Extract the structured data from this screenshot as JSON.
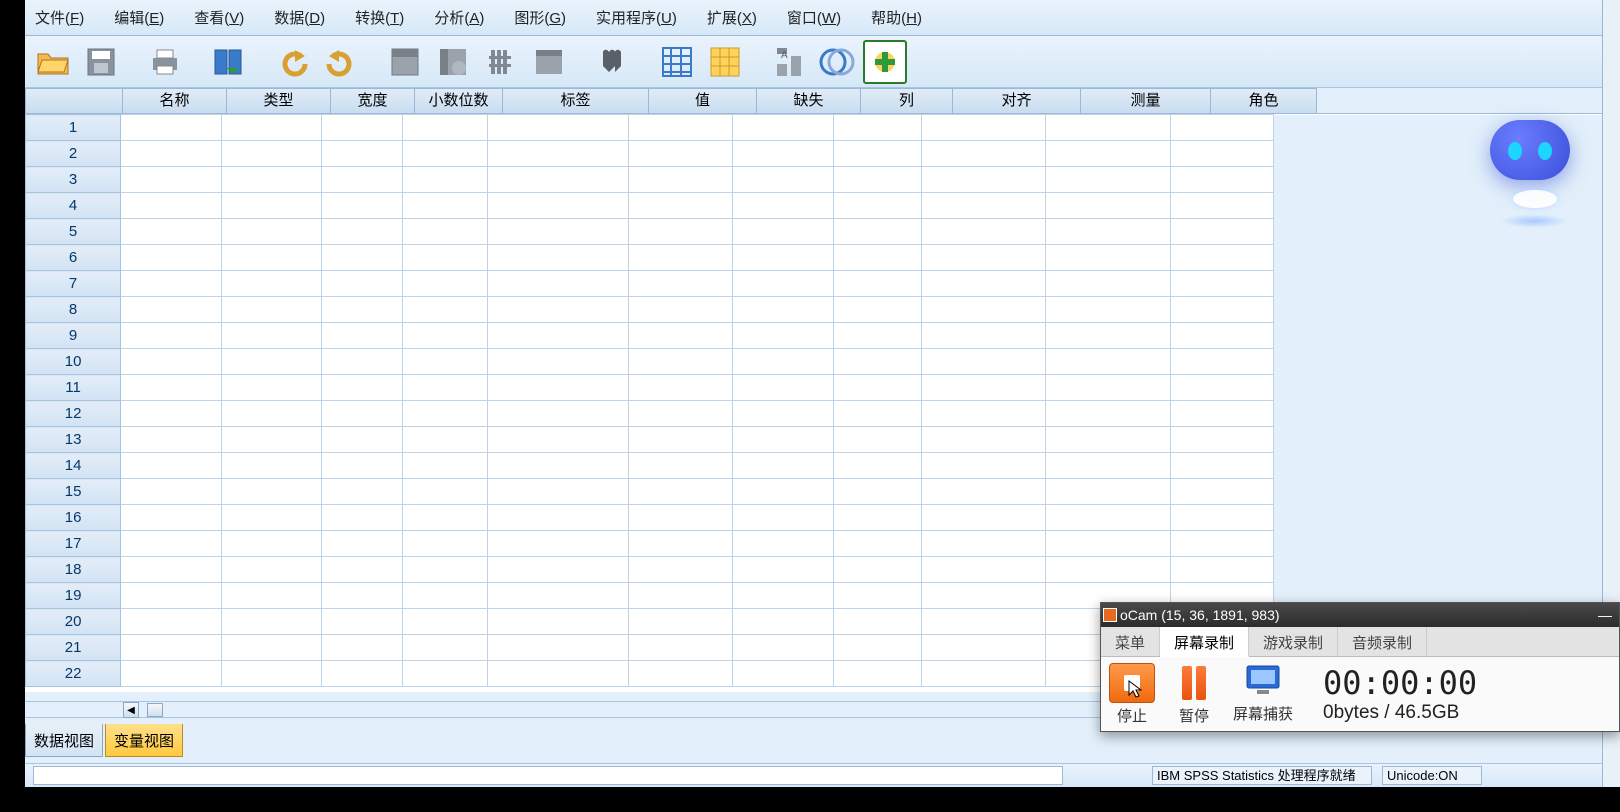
{
  "menu": {
    "file": {
      "label": "文件",
      "key": "F"
    },
    "edit": {
      "label": "编辑",
      "key": "E"
    },
    "view": {
      "label": "查看",
      "key": "V"
    },
    "data": {
      "label": "数据",
      "key": "D"
    },
    "transform": {
      "label": "转换",
      "key": "T"
    },
    "analyze": {
      "label": "分析",
      "key": "A"
    },
    "graphs": {
      "label": "图形",
      "key": "G"
    },
    "utilities": {
      "label": "实用程序",
      "key": "U"
    },
    "extensions": {
      "label": "扩展",
      "key": "X"
    },
    "window": {
      "label": "窗口",
      "key": "W"
    },
    "help": {
      "label": "帮助",
      "key": "H"
    }
  },
  "columns": {
    "name": "名称",
    "type": "类型",
    "width": "宽度",
    "decimals": "小数位数",
    "label": "标签",
    "values": "值",
    "missing": "缺失",
    "columns_col": "列",
    "align": "对齐",
    "measure": "测量",
    "role": "角色"
  },
  "row_count": 22,
  "tabs": {
    "data_view": "数据视图",
    "variable_view": "变量视图"
  },
  "status": {
    "processor": "IBM SPSS Statistics 处理程序就绪",
    "unicode": "Unicode:ON"
  },
  "recorder": {
    "title": "oCam (15, 36, 1891, 983)",
    "tabs": {
      "menu": "菜单",
      "screen": "屏幕录制",
      "game": "游戏录制",
      "audio": "音频录制"
    },
    "buttons": {
      "stop": "停止",
      "pause": "暂停",
      "capture": "屏幕捕获"
    },
    "timer": "00:00:00",
    "size": "0bytes / 46.5GB"
  }
}
